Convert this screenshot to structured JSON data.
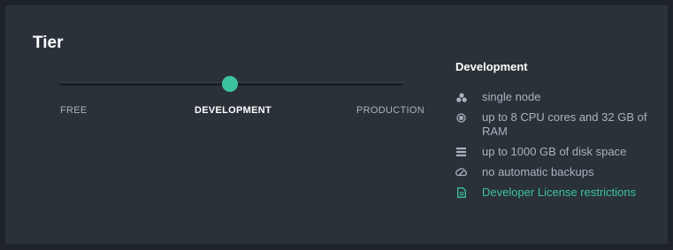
{
  "card": {
    "title": "Tier"
  },
  "slider": {
    "options": [
      "FREE",
      "DEVELOPMENT",
      "PRODUCTION"
    ],
    "selected": "DEVELOPMENT",
    "accent_color": "#3dc2a0"
  },
  "details": {
    "title": "Development",
    "features": [
      {
        "icon": "nodes-icon",
        "text": "single node"
      },
      {
        "icon": "cpu-icon",
        "text": "up to 8 CPU cores and 32 GB of RAM"
      },
      {
        "icon": "storage-icon",
        "text": "up to 1000 GB of disk space"
      },
      {
        "icon": "backup-icon",
        "text": "no automatic backups"
      },
      {
        "icon": "document-icon",
        "text": "Developer License restrictions",
        "link": true
      }
    ]
  }
}
